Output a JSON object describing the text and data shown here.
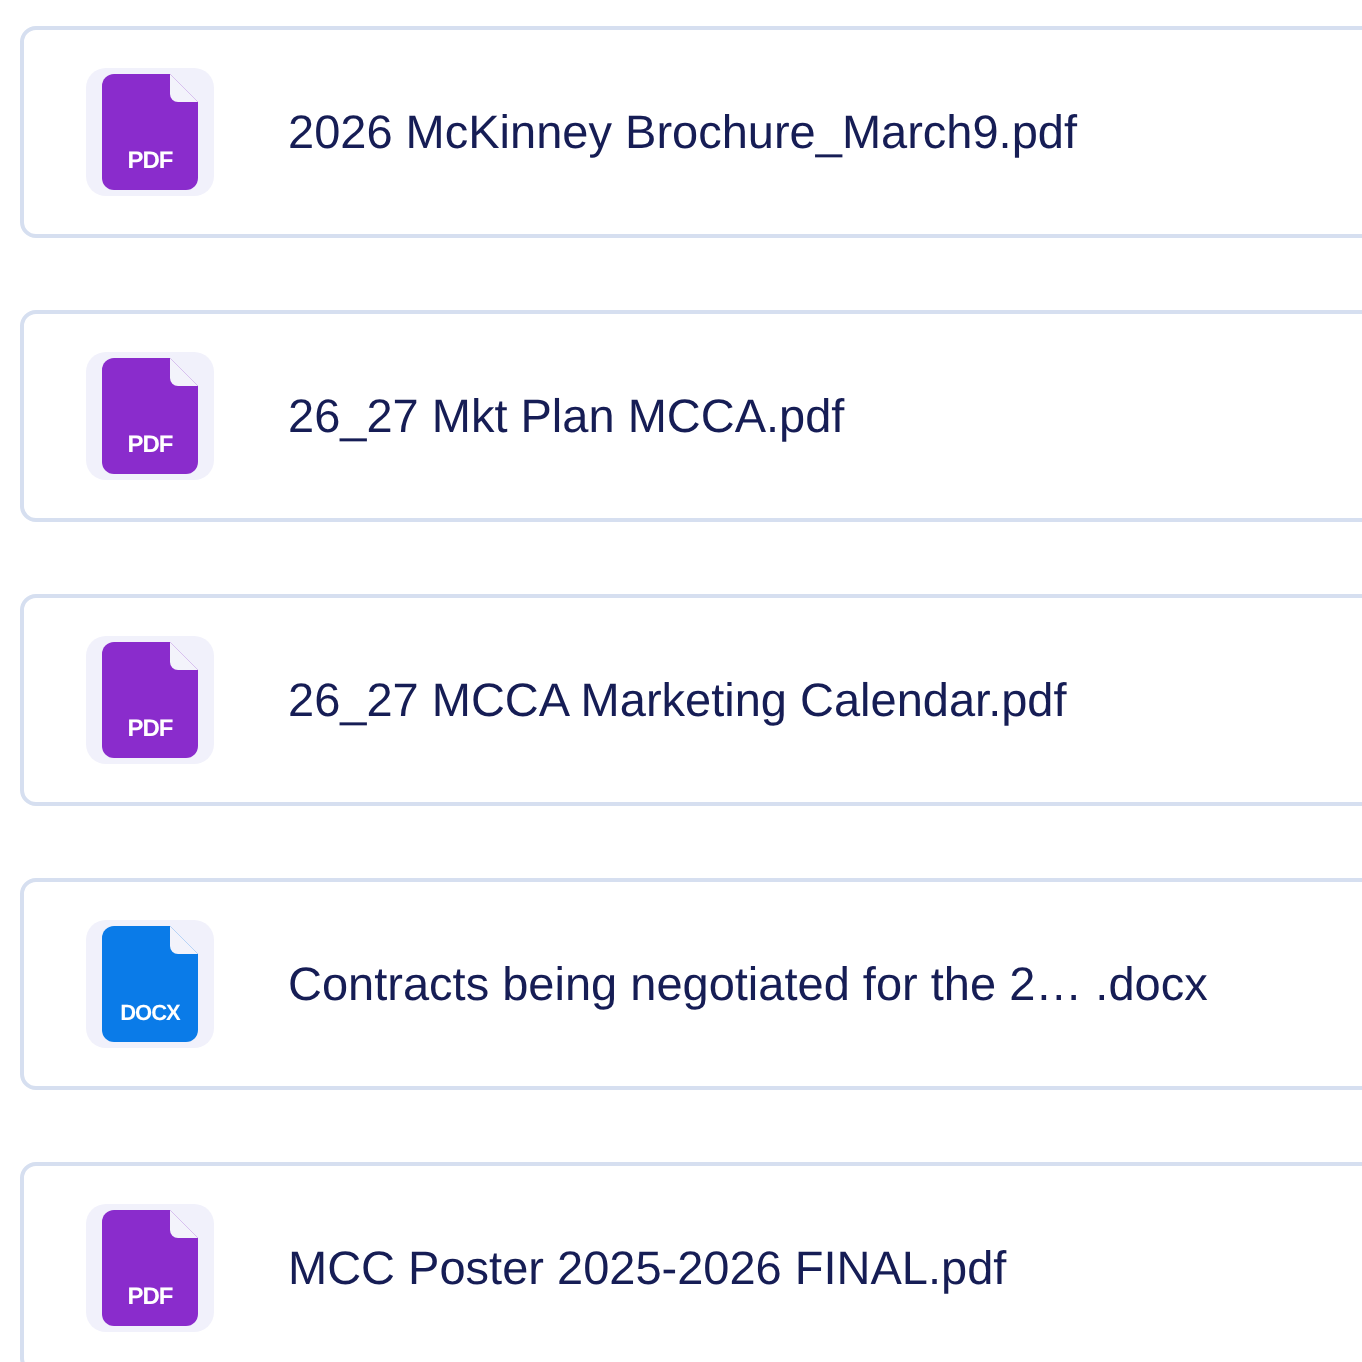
{
  "files": [
    {
      "kind": "pdf",
      "badge": "PDF",
      "name": "2026 McKinney Brochure_March9.pdf"
    },
    {
      "kind": "pdf",
      "badge": "PDF",
      "name": "26_27 Mkt Plan MCCA.pdf"
    },
    {
      "kind": "pdf",
      "badge": "PDF",
      "name": "26_27 MCCA Marketing Calendar.pdf"
    },
    {
      "kind": "docx",
      "badge": "DOCX",
      "name": "Contracts being negotiated for the 2… .docx"
    },
    {
      "kind": "pdf",
      "badge": "PDF",
      "name": "MCC Poster 2025-2026 FINAL.pdf"
    }
  ]
}
